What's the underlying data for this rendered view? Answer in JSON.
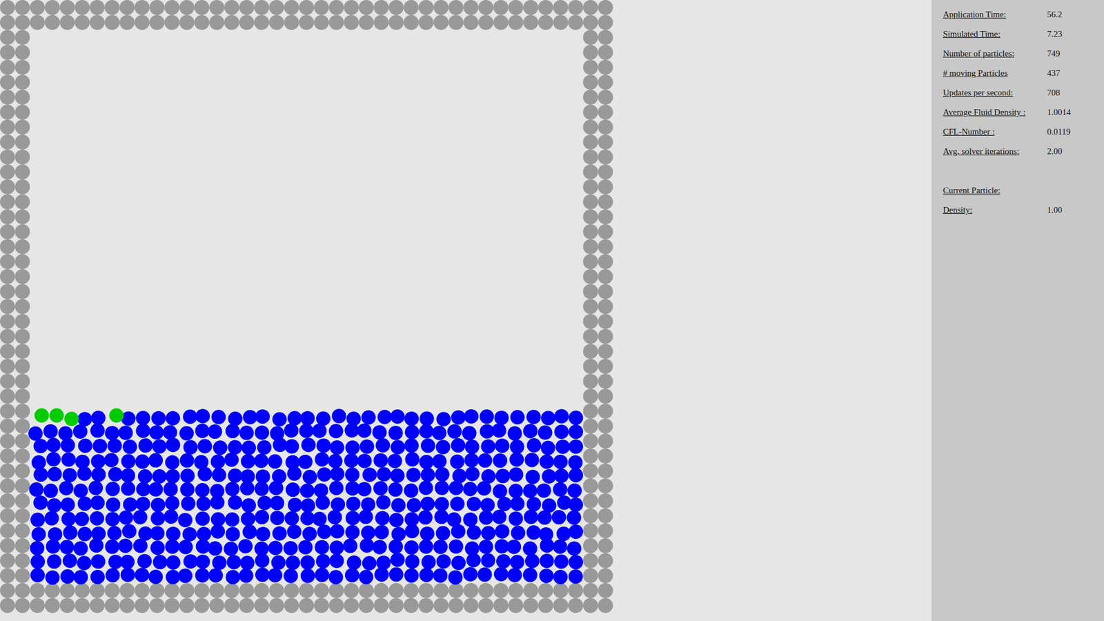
{
  "scene": {
    "boundary": {
      "color": "#999999"
    },
    "fluid": {
      "level": 0.31,
      "color": "#0000ff"
    },
    "marked_particles": [
      {
        "selected": true,
        "color": "#00cc00"
      },
      {
        "selected": true,
        "color": "#00cc00"
      },
      {
        "selected": true,
        "color": "#00cc00"
      },
      {
        "selected": true,
        "color": "#00cc00"
      }
    ]
  },
  "stats": [
    {
      "label": "Application Time:",
      "value": "56.2"
    },
    {
      "label": "Simulated Time:",
      "value": "7.23"
    },
    {
      "label": "Number of particles:",
      "value": "749"
    },
    {
      "label": "# moving Particles",
      "value": "437"
    },
    {
      "label": "Updates per second:",
      "value": "708"
    },
    {
      "label": "Average Fluid Density :",
      "value": "1.0014"
    },
    {
      "label": "CFL-Number :",
      "value": "0.0119"
    },
    {
      "label": "Avg. solver iterations:",
      "value": "2.00"
    }
  ],
  "current_particle": {
    "title": "Current Particle:",
    "rows": [
      {
        "label": "Density:",
        "value": "1.00"
      }
    ]
  }
}
